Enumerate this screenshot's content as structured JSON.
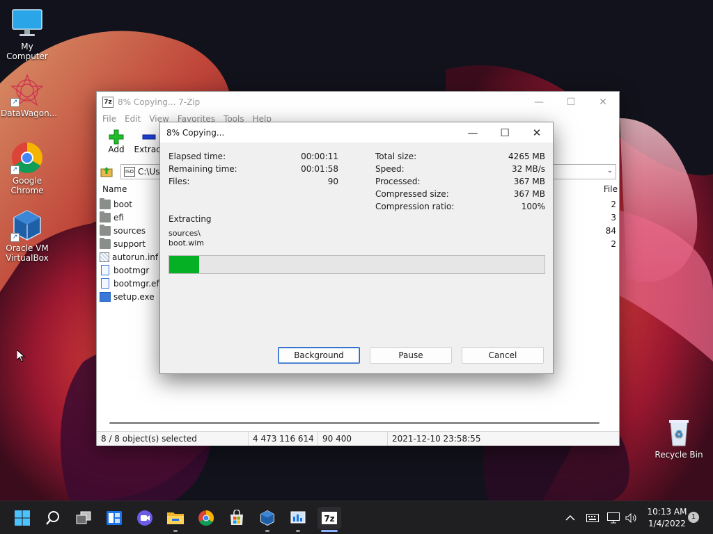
{
  "desktop": {
    "icons": [
      {
        "label": "My Computer"
      },
      {
        "label": "DataWagon..."
      },
      {
        "label": "Google Chrome"
      },
      {
        "label": "Oracle VM VirtualBox"
      },
      {
        "label": "Recycle Bin"
      }
    ]
  },
  "main_window": {
    "title": "8% Copying... 7-Zip",
    "menu": [
      "File",
      "Edit",
      "View",
      "Favorites",
      "Tools",
      "Help"
    ],
    "toolbar": {
      "add_label": "Add",
      "extract_label": "Extract"
    },
    "address": "C:\\Use",
    "columns": {
      "name": "Name",
      "file": "File"
    },
    "files": [
      {
        "name": "boot",
        "type": "folder",
        "files": "2"
      },
      {
        "name": "efi",
        "type": "folder",
        "files": "3"
      },
      {
        "name": "sources",
        "type": "folder",
        "files": "84"
      },
      {
        "name": "support",
        "type": "folder",
        "files": "2"
      },
      {
        "name": "autorun.inf",
        "type": "inf",
        "files": ""
      },
      {
        "name": "bootmgr",
        "type": "doc",
        "files": ""
      },
      {
        "name": "bootmgr.efi",
        "type": "doc",
        "files": ""
      },
      {
        "name": "setup.exe",
        "type": "exe",
        "files": ""
      }
    ],
    "status": {
      "selected": "8 / 8 object(s) selected",
      "size": "4 473 116 614",
      "packed": "90 400",
      "modified": "2021-12-10 23:58:55"
    }
  },
  "dialog": {
    "title": "8% Copying...",
    "progress_percent": 8,
    "left_stats": {
      "elapsed_label": "Elapsed time:",
      "elapsed_value": "00:00:11",
      "remaining_label": "Remaining time:",
      "remaining_value": "00:01:58",
      "files_label": "Files:",
      "files_value": "90"
    },
    "right_stats": {
      "total_label": "Total size:",
      "total_value": "4265 MB",
      "speed_label": "Speed:",
      "speed_value": "32 MB/s",
      "processed_label": "Processed:",
      "processed_value": "367 MB",
      "compressed_label": "Compressed size:",
      "compressed_value": "367 MB",
      "ratio_label": "Compression ratio:",
      "ratio_value": "100%"
    },
    "operation": "Extracting",
    "current_path": "sources\\",
    "current_file": "boot.wim",
    "buttons": {
      "background": "Background",
      "pause": "Pause",
      "cancel": "Cancel"
    }
  },
  "taskbar": {
    "clock_time": "10:13 AM",
    "clock_date": "1/4/2022",
    "notification_count": "1",
    "pinned": [
      "start-icon",
      "search-icon",
      "task-view-icon",
      "widgets-icon",
      "chat-icon",
      "file-explorer-icon",
      "chrome-icon",
      "store-icon",
      "virtualbox-icon",
      "datawagon-icon",
      "7zip-icon"
    ]
  },
  "colors": {
    "progress": "#06b025",
    "accent": "#1c5fc4",
    "taskbar": "#1f1f22"
  }
}
